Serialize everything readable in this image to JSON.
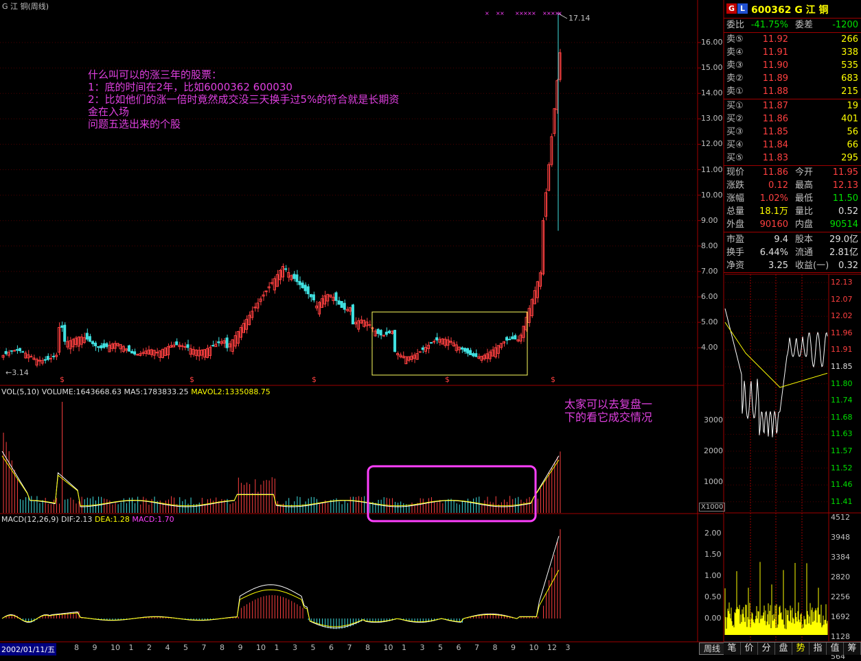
{
  "title": "G 江  铜(周线)",
  "annotation_main": [
    "什么叫可以的涨三年的股票：",
    "1：底的时间在2年，比如6000362     600030",
    "2：比如他们的涨一倍时竟然成交没三天换手过5%的符合就是长期资",
    "金在入场",
    "问题五选出来的个股"
  ],
  "annotation_volume": [
    "太家可以去复盘一",
    "下的看它成交情况"
  ],
  "price_high_label": "17.14",
  "price_low_label": "3.14",
  "price_axis": [
    "16.00",
    "15.00",
    "14.00",
    "13.00",
    "12.00",
    "11.00",
    "10.00",
    "9.00",
    "8.00",
    "7.00",
    "6.00",
    "5.00",
    "4.00"
  ],
  "volume_header": {
    "name": "VOL(5,10)",
    "volume": "VOLUME:1643668.63",
    "ma5": "MA5:1783833.25",
    "mavol2": "MAVOL2:1335088.75"
  },
  "volume_axis": [
    "3000",
    "2000",
    "1000"
  ],
  "volume_unit": "X1000",
  "macd_header": {
    "name": "MACD(12,26,9)",
    "dif": "DIF:2.13",
    "dea": "DEA:1.28",
    "macd": "MACD:1.70"
  },
  "macd_axis": [
    "2.00",
    "1.50",
    "1.00",
    "0.50",
    "0.00"
  ],
  "date_label": "2002/01/11/五",
  "time_axis": [
    "8",
    "9",
    "10",
    "1",
    "2",
    "4",
    "5",
    "7",
    "8",
    "9",
    "10",
    "1",
    "3",
    "5",
    "6",
    "7",
    "8",
    "10",
    "1",
    "3",
    "5",
    "6",
    "7",
    "8",
    "9",
    "10",
    "12",
    "3"
  ],
  "period_button": "周线",
  "quote": {
    "badge1": "G",
    "badge2": "L",
    "stock": "600362 G 江  铜",
    "weibi_label": "委比",
    "weibi": "-41.75%",
    "weicha_label": "委差",
    "weicha": "-1200",
    "sells": [
      {
        "label": "卖⑤",
        "price": "11.92",
        "vol": "266"
      },
      {
        "label": "卖④",
        "price": "11.91",
        "vol": "338"
      },
      {
        "label": "卖③",
        "price": "11.90",
        "vol": "535"
      },
      {
        "label": "卖②",
        "price": "11.89",
        "vol": "683"
      },
      {
        "label": "卖①",
        "price": "11.88",
        "vol": "215"
      }
    ],
    "buys": [
      {
        "label": "买①",
        "price": "11.87",
        "vol": "19"
      },
      {
        "label": "买②",
        "price": "11.86",
        "vol": "401"
      },
      {
        "label": "买③",
        "price": "11.85",
        "vol": "56"
      },
      {
        "label": "买④",
        "price": "11.84",
        "vol": "66"
      },
      {
        "label": "买⑤",
        "price": "11.83",
        "vol": "295"
      }
    ],
    "stats": [
      {
        "l1": "现价",
        "v1": "11.86",
        "c1": "red",
        "l2": "今开",
        "v2": "11.95",
        "c2": "red"
      },
      {
        "l1": "涨跌",
        "v1": "0.12",
        "c1": "red",
        "l2": "最高",
        "v2": "12.13",
        "c2": "red"
      },
      {
        "l1": "涨幅",
        "v1": "1.02%",
        "c1": "red",
        "l2": "最低",
        "v2": "11.50",
        "c2": "green"
      },
      {
        "l1": "总量",
        "v1": "18.1万",
        "c1": "yv",
        "l2": "量比",
        "v2": "0.52",
        "c2": "wt"
      },
      {
        "l1": "外盘",
        "v1": "90160",
        "c1": "red",
        "l2": "内盘",
        "v2": "90514",
        "c2": "green"
      }
    ],
    "finance": [
      {
        "l1": "市盈",
        "v1": "9.4",
        "l2": "股本",
        "v2": "29.0亿"
      },
      {
        "l1": "换手",
        "v1": "6.44%",
        "l2": "流通",
        "v2": "2.81亿"
      },
      {
        "l1": "净资",
        "v1": "3.25",
        "l2": "收益(一)",
        "v2": "0.32"
      }
    ]
  },
  "minute_price_axis": [
    "12.13",
    "12.07",
    "12.02",
    "11.96",
    "11.91",
    "11.85",
    "11.80",
    "11.74",
    "11.68",
    "11.63",
    "11.57",
    "11.52",
    "11.46",
    "11.41"
  ],
  "minute_vol_axis": [
    "4512",
    "3948",
    "3384",
    "2820",
    "2256",
    "1692",
    "1128",
    "564"
  ],
  "bottom_tabs": [
    "笔",
    "价",
    "分",
    "盘",
    "势",
    "指",
    "值",
    "筹"
  ],
  "active_tab": "势",
  "colors": {
    "up": "#ff4040",
    "down": "#40e0e0",
    "ma": "#ffff00",
    "frame": "#a00000",
    "annotation": "#e040e0",
    "box_yellow": "#ffff60",
    "box_magenta": "#ff40ff"
  }
}
